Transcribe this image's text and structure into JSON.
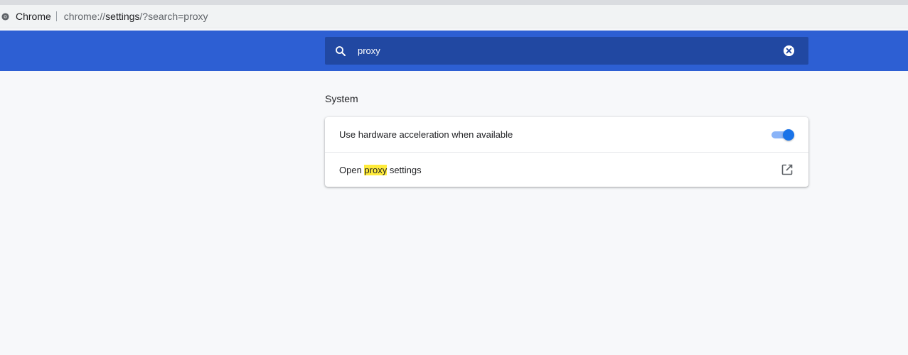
{
  "browser": {
    "app_name": "Chrome",
    "url_prefix": "chrome://",
    "url_host": "settings",
    "url_rest": "/?search=proxy"
  },
  "search": {
    "value": "proxy",
    "icon": "search-icon",
    "clear_icon": "close-circle-icon"
  },
  "section": {
    "title": "System",
    "rows": [
      {
        "label": "Use hardware acceleration when available",
        "control": "toggle",
        "checked": true
      },
      {
        "label_before": "Open ",
        "label_highlight": "proxy",
        "label_after": " settings",
        "control": "external-link-icon"
      }
    ]
  },
  "colors": {
    "header": "#2d5fd3",
    "search_box": "#2148a2",
    "toggle_on": "#1a73e8",
    "highlight": "#ffeb3b"
  }
}
